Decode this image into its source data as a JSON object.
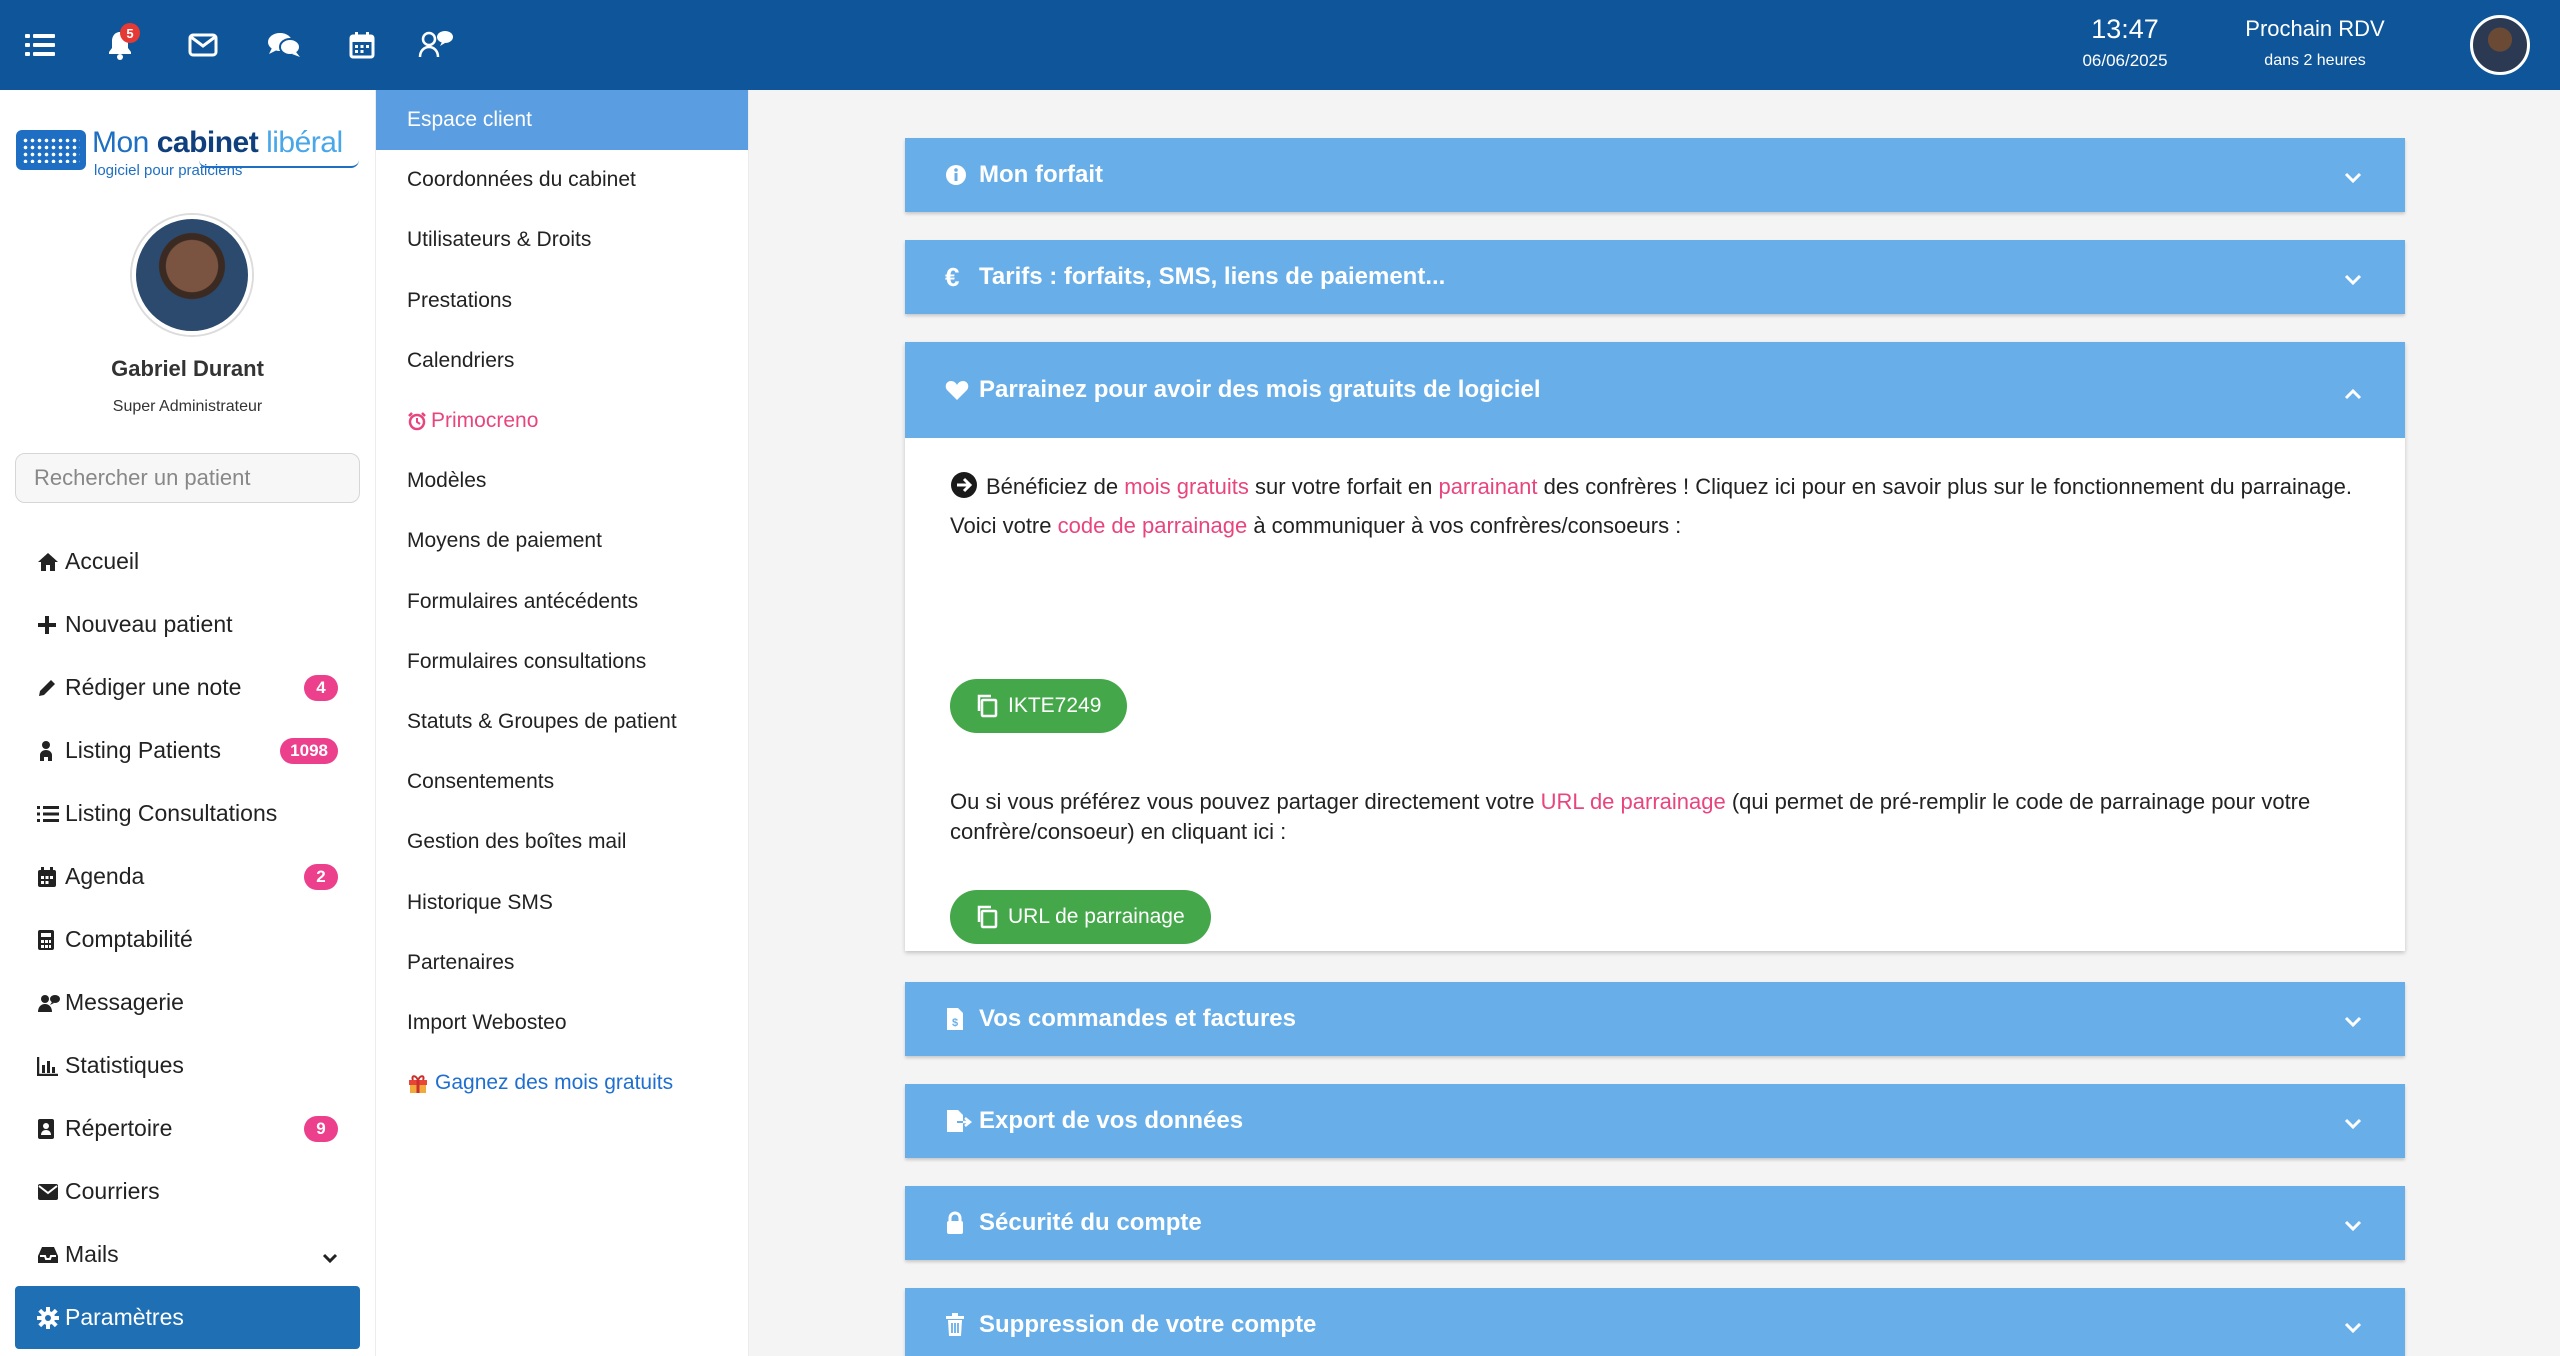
{
  "topbar": {
    "notifications_count": "5",
    "time": "13:47",
    "date": "06/06/2025",
    "next_appointment_label": "Prochain RDV",
    "next_appointment_when": "dans 2 heures"
  },
  "logo": {
    "brand_part1": "Mon ",
    "brand_part2": "cabinet",
    "brand_part3": " libéral",
    "tagline": "logiciel pour praticiens"
  },
  "profile": {
    "name": "Gabriel Durant",
    "role": "Super Administrateur"
  },
  "search": {
    "placeholder": "Rechercher un patient"
  },
  "menu": {
    "items": [
      {
        "label": "Accueil",
        "icon": "home-icon"
      },
      {
        "label": "Nouveau patient",
        "icon": "plus-icon"
      },
      {
        "label": "Rédiger une note",
        "icon": "pencil-icon",
        "badge": "4"
      },
      {
        "label": "Listing Patients",
        "icon": "patient-icon",
        "badge": "1098"
      },
      {
        "label": "Listing Consultations",
        "icon": "list-icon"
      },
      {
        "label": "Agenda",
        "icon": "calendar-icon",
        "badge": "2"
      },
      {
        "label": "Comptabilité",
        "icon": "calculator-icon"
      },
      {
        "label": "Messagerie",
        "icon": "users-icon"
      },
      {
        "label": "Statistiques",
        "icon": "chart-icon"
      },
      {
        "label": "Répertoire",
        "icon": "address-book-icon",
        "badge": "9"
      },
      {
        "label": "Courriers",
        "icon": "envelope-icon"
      },
      {
        "label": "Mails",
        "icon": "inbox-icon"
      },
      {
        "label": "Paramètres",
        "icon": "gear-icon"
      }
    ]
  },
  "submenu": {
    "items": [
      "Espace client",
      "Coordonnées du cabinet",
      "Utilisateurs & Droits",
      "Prestations",
      "Calendriers",
      "Primocreno",
      "Modèles",
      "Moyens de paiement",
      "Formulaires antécédents",
      "Formulaires consultations",
      "Statuts & Groupes de patient",
      "Consentements",
      "Gestion des boîtes mail",
      "Historique SMS",
      "Partenaires",
      "Import Webosteo",
      "Gagnez des mois gratuits"
    ]
  },
  "panels": {
    "forfait": "Mon forfait",
    "tarifs": "Tarifs : forfaits, SMS, liens de paiement...",
    "parrainage": "Parrainez pour avoir des mois gratuits de logiciel",
    "commandes": "Vos commandes et factures",
    "export": "Export de vos données",
    "securite": "Sécurité du compte",
    "suppression": "Suppression de votre compte"
  },
  "parrainage": {
    "p1_a": "Bénéficiez de ",
    "p1_b": "mois gratuits",
    "p1_c": " sur votre forfait en ",
    "p1_d": "parrainant",
    "p1_e": " des confrères ! Cliquez ici pour en savoir plus sur le fonctionnement du parrainage. Voici votre ",
    "p1_f": "code de parrainage",
    "p1_g": " à communiquer à vos confrères/consoeurs :",
    "code": "IKTE7249",
    "p2_a": "Ou si vous préférez vous pouvez partager directement votre ",
    "p2_b": "URL de parrainage",
    "p2_c": " (qui permet de pré-remplir le code de parrainage pour votre confrère/consoeur) en cliquant ici :",
    "url_button": "URL de parrainage"
  },
  "colors": {
    "topbar": "#0e5699",
    "panel": "#68aee9",
    "active_menu": "#1f6fb5",
    "badge": "#ec3f8c",
    "green": "#44a84a"
  }
}
